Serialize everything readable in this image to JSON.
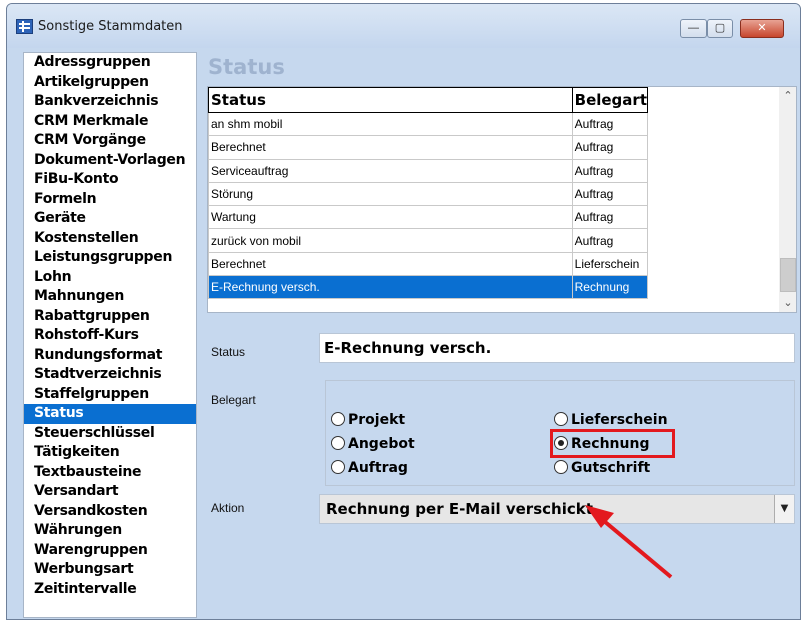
{
  "window": {
    "title": "Sonstige Stammdaten",
    "min_glyph": "—",
    "max_glyph": "▢",
    "close_glyph": "✕"
  },
  "nav": {
    "selected": "Status",
    "items": [
      "Adressgruppen",
      "Artikelgruppen",
      "Bankverzeichnis",
      "CRM Merkmale",
      "CRM Vorgänge",
      "Dokument-Vorlagen",
      "FiBu-Konto",
      "Formeln",
      "Geräte",
      "Kostenstellen",
      "Leistungsgruppen",
      "Lohn",
      "Mahnungen",
      "Rabattgruppen",
      "Rohstoff-Kurs",
      "Rundungsformat",
      "Stadtverzeichnis",
      "Staffelgruppen",
      "Status",
      "Steuerschlüssel",
      "Tätigkeiten",
      "Textbausteine",
      "Versandart",
      "Versandkosten",
      "Währungen",
      "Warengruppen",
      "Werbungsart",
      "Zeitintervalle"
    ]
  },
  "panel": {
    "heading": "Status",
    "table": {
      "columns": [
        "Status",
        "Belegart"
      ],
      "rows": [
        [
          "an shm mobil",
          "Auftrag"
        ],
        [
          "Berechnet",
          "Auftrag"
        ],
        [
          "Serviceauftrag",
          "Auftrag"
        ],
        [
          "Störung",
          "Auftrag"
        ],
        [
          "Wartung",
          "Auftrag"
        ],
        [
          "zurück von mobil",
          "Auftrag"
        ],
        [
          "Berechnet",
          "Lieferschein"
        ],
        [
          "E-Rechnung versch.",
          "Rechnung"
        ]
      ],
      "selected_row": 7
    },
    "scroll_up_glyph": "⌃",
    "scroll_down_glyph": "⌄"
  },
  "form": {
    "status_label": "Status",
    "status_value": "E-Rechnung versch.",
    "belegart_label": "Belegart",
    "belegart_options": {
      "projekt": "Projekt",
      "angebot": "Angebot",
      "auftrag": "Auftrag",
      "lieferschein": "Lieferschein",
      "rechnung": "Rechnung",
      "gutschrift": "Gutschrift"
    },
    "belegart_selected": "Rechnung",
    "aktion_label": "Aktion",
    "aktion_value": "Rechnung per E-Mail verschickt",
    "dropdown_glyph": "▼"
  },
  "annotation": {
    "highlight_color": "#e3191e",
    "arrow_color": "#e3191e"
  }
}
